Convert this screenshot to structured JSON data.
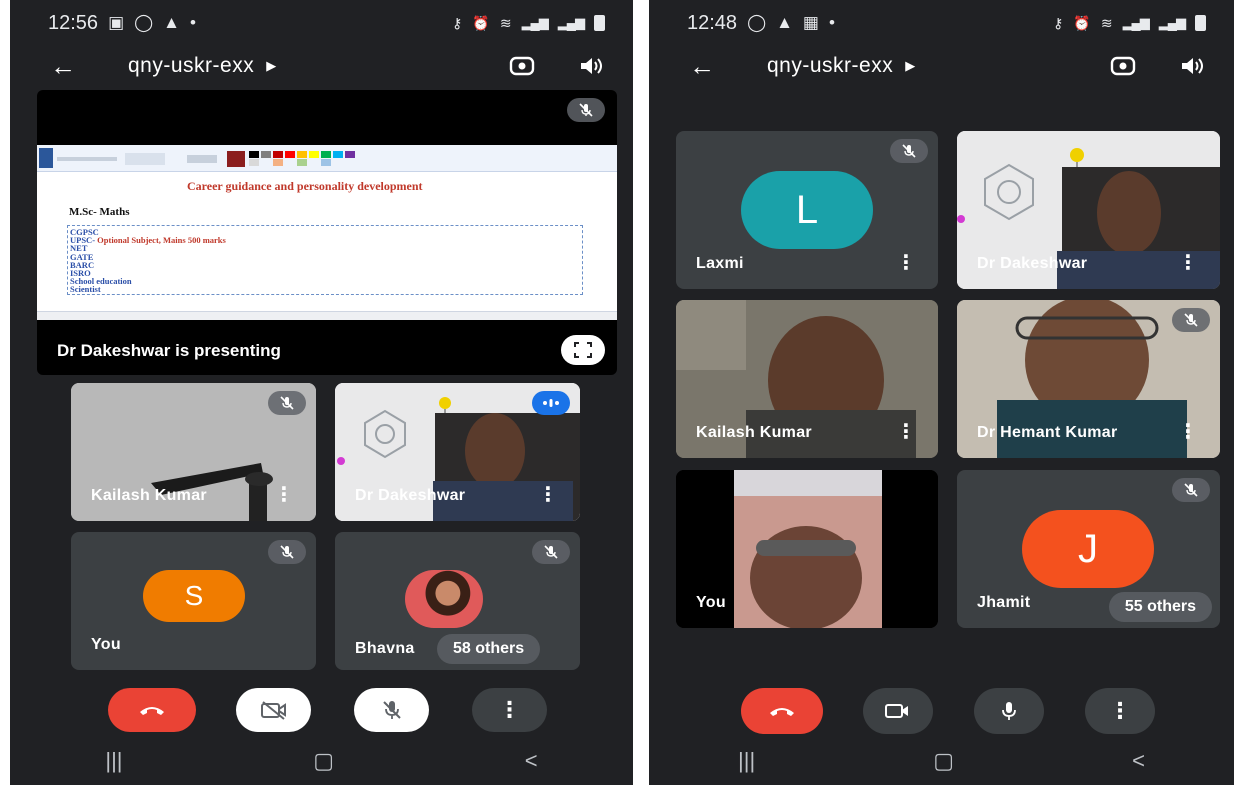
{
  "left": {
    "status": {
      "time": "12:56"
    },
    "appbar": {
      "title": "qny-uskr-exx"
    },
    "presentation": {
      "label": "Dr Dakeshwar is presenting",
      "slide": {
        "heading": "Career guidance and personality development",
        "subheading": "M.Sc- Maths",
        "items": [
          "CGPSC",
          "UPSC- ",
          "NET",
          "GATE",
          "BARC",
          "ISRO",
          "School education",
          "Scientist"
        ],
        "upsc_note": "Optional Subject, Mains 500 marks"
      }
    },
    "tiles": {
      "t1": {
        "name": "Kailash Kumar"
      },
      "t2": {
        "name": "Dr Dakeshwar"
      },
      "t3": {
        "name": "You",
        "initial": "S"
      },
      "t4": {
        "name": "Bhavna",
        "others": "58 others"
      }
    }
  },
  "right": {
    "status": {
      "time": "12:48"
    },
    "appbar": {
      "title": "qny-uskr-exx"
    },
    "tiles": {
      "t1": {
        "name": "Laxmi",
        "initial": "L"
      },
      "t2": {
        "name": "Dr Dakeshwar"
      },
      "t3": {
        "name": "Kailash Kumar"
      },
      "t4": {
        "name": "Dr Hemant Kumar"
      },
      "t5": {
        "name": "You"
      },
      "t6": {
        "name": "Jhamit",
        "initial": "J",
        "others": "55 others"
      }
    }
  },
  "colors": {
    "background": "#202124",
    "tile": "#3c4043",
    "end_call": "#ea4335",
    "avatar_orange": "#f07c00",
    "avatar_teal": "#1aa1a9",
    "avatar_red_orange": "#f4511e",
    "speaking_blue": "#1a73e8"
  }
}
